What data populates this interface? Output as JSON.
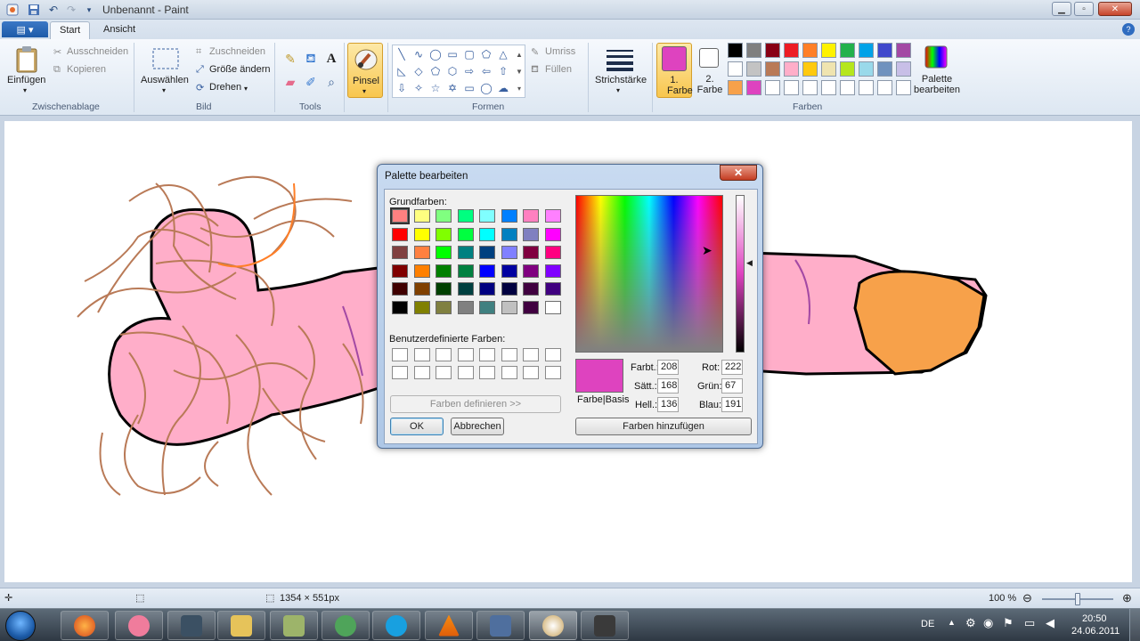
{
  "window": {
    "title": "Unbenannt - Paint"
  },
  "tabs": [
    {
      "label": "Start"
    },
    {
      "label": "Ansicht"
    }
  ],
  "ribbon": {
    "clipboard": {
      "paste": "Einfügen",
      "cut": "Ausschneiden",
      "copy": "Kopieren",
      "group": "Zwischenablage"
    },
    "image": {
      "select": "Auswählen",
      "crop": "Zuschneiden",
      "resize": "Größe ändern",
      "rotate": "Drehen",
      "group": "Bild"
    },
    "tools": {
      "group": "Tools"
    },
    "brush": {
      "label": "Pinsel"
    },
    "shapes": {
      "outline": "Umriss",
      "fill": "Füllen",
      "group": "Formen"
    },
    "size": {
      "label": "Strichstärke"
    },
    "colors": {
      "color1": "1. Farbe",
      "color2": "2. Farbe",
      "color1_value": "#de43bf",
      "color2_value": "#ffffff",
      "edit": "Palette bearbeiten",
      "group": "Farben",
      "palette_row1": [
        "#000000",
        "#7f7f7f",
        "#880015",
        "#ed1c24",
        "#ff7f27",
        "#fff200",
        "#22b14c",
        "#00a2e8",
        "#3f48cc",
        "#a349a4"
      ],
      "palette_row2": [
        "#ffffff",
        "#c3c3c3",
        "#b97a57",
        "#ffaec9",
        "#ffc90e",
        "#efe4b0",
        "#b5e61d",
        "#99d9ea",
        "#7092be",
        "#c8bfe7"
      ],
      "palette_row3": [
        "#f7a14a",
        "#de43bf",
        "#ffffff",
        "#ffffff",
        "#ffffff",
        "#ffffff",
        "#ffffff",
        "#ffffff",
        "#ffffff",
        "#ffffff"
      ]
    }
  },
  "status": {
    "dimensions": "1354 × 551px",
    "zoom": "100 %",
    "zoom_level": 1.0
  },
  "taskbar": {
    "lang": "DE",
    "time": "20:50",
    "date": "24.06.2011"
  },
  "dialog": {
    "title": "Palette bearbeiten",
    "basic_label": "Grundfarben:",
    "custom_label": "Benutzerdefinierte Farben:",
    "define_button": "Farben definieren >>",
    "ok": "OK",
    "cancel": "Abbrechen",
    "add_button": "Farben hinzufügen",
    "preview_label": "Farbe|Basis",
    "preview_color": "#de43bf",
    "hue_label": "Farbt.:",
    "hue": "208",
    "sat_label": "Sätt.:",
    "sat": "168",
    "lum_label": "Hell.:",
    "lum": "136",
    "red_label": "Rot:",
    "red": "222",
    "green_label": "Grün:",
    "green": "67",
    "blue_label": "Blau:",
    "blue": "191",
    "basic_colors": [
      [
        "#ff8080",
        "#ffff80",
        "#80ff80",
        "#00ff80",
        "#80ffff",
        "#0080ff",
        "#ff80c0",
        "#ff80ff"
      ],
      [
        "#ff0000",
        "#ffff00",
        "#80ff00",
        "#00ff40",
        "#00ffff",
        "#0080c0",
        "#8080c0",
        "#ff00ff"
      ],
      [
        "#804040",
        "#ff8040",
        "#00ff00",
        "#008080",
        "#004080",
        "#8080ff",
        "#800040",
        "#ff0080"
      ],
      [
        "#800000",
        "#ff8000",
        "#008000",
        "#008040",
        "#0000ff",
        "#0000a0",
        "#800080",
        "#8000ff"
      ],
      [
        "#400000",
        "#804000",
        "#004000",
        "#004040",
        "#000080",
        "#000040",
        "#400040",
        "#400080"
      ],
      [
        "#000000",
        "#808000",
        "#808040",
        "#808080",
        "#408080",
        "#c0c0c0",
        "#400040",
        "#ffffff"
      ]
    ]
  }
}
